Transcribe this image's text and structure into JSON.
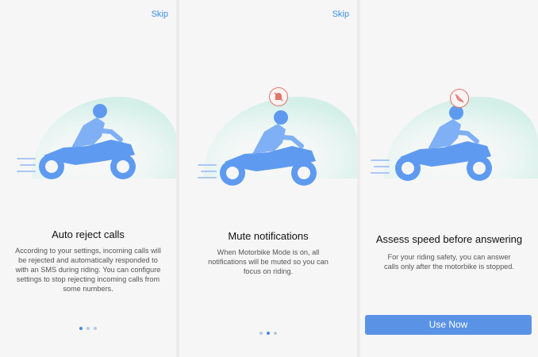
{
  "colors": {
    "accent": "#3a8ee6",
    "bike": "#5e9af0",
    "bike_dark": "#4a84dc",
    "rider": "#7fb0f5",
    "glow": "#d4f0ea",
    "badge_red": "#e0766a"
  },
  "screens": [
    {
      "skip_label": "Skip",
      "title": "Auto reject calls",
      "description": "According to your settings, incoming calls will be rejected and automatically responded to with an SMS during riding. You can configure settings to stop rejecting incoming calls from some numbers.",
      "page_indicator": {
        "current": 1,
        "total": 3
      },
      "illustration_icon": "motorbike-rider-icon"
    },
    {
      "skip_label": "Skip",
      "title": "Mute notifications",
      "description": "When Motorbike Mode is on, all notifications will be muted so you can focus on riding.",
      "page_indicator": {
        "current": 2,
        "total": 3
      },
      "illustration_icon": "motorbike-rider-icon",
      "badge_icon": "bell-muted-icon"
    },
    {
      "title": "Assess speed before answering",
      "description": "For your riding safety, you can answer calls only after the motorbike is stopped.",
      "button_label": "Use Now",
      "illustration_icon": "motorbike-rider-icon",
      "badge_icon": "phone-blocked-icon"
    }
  ]
}
